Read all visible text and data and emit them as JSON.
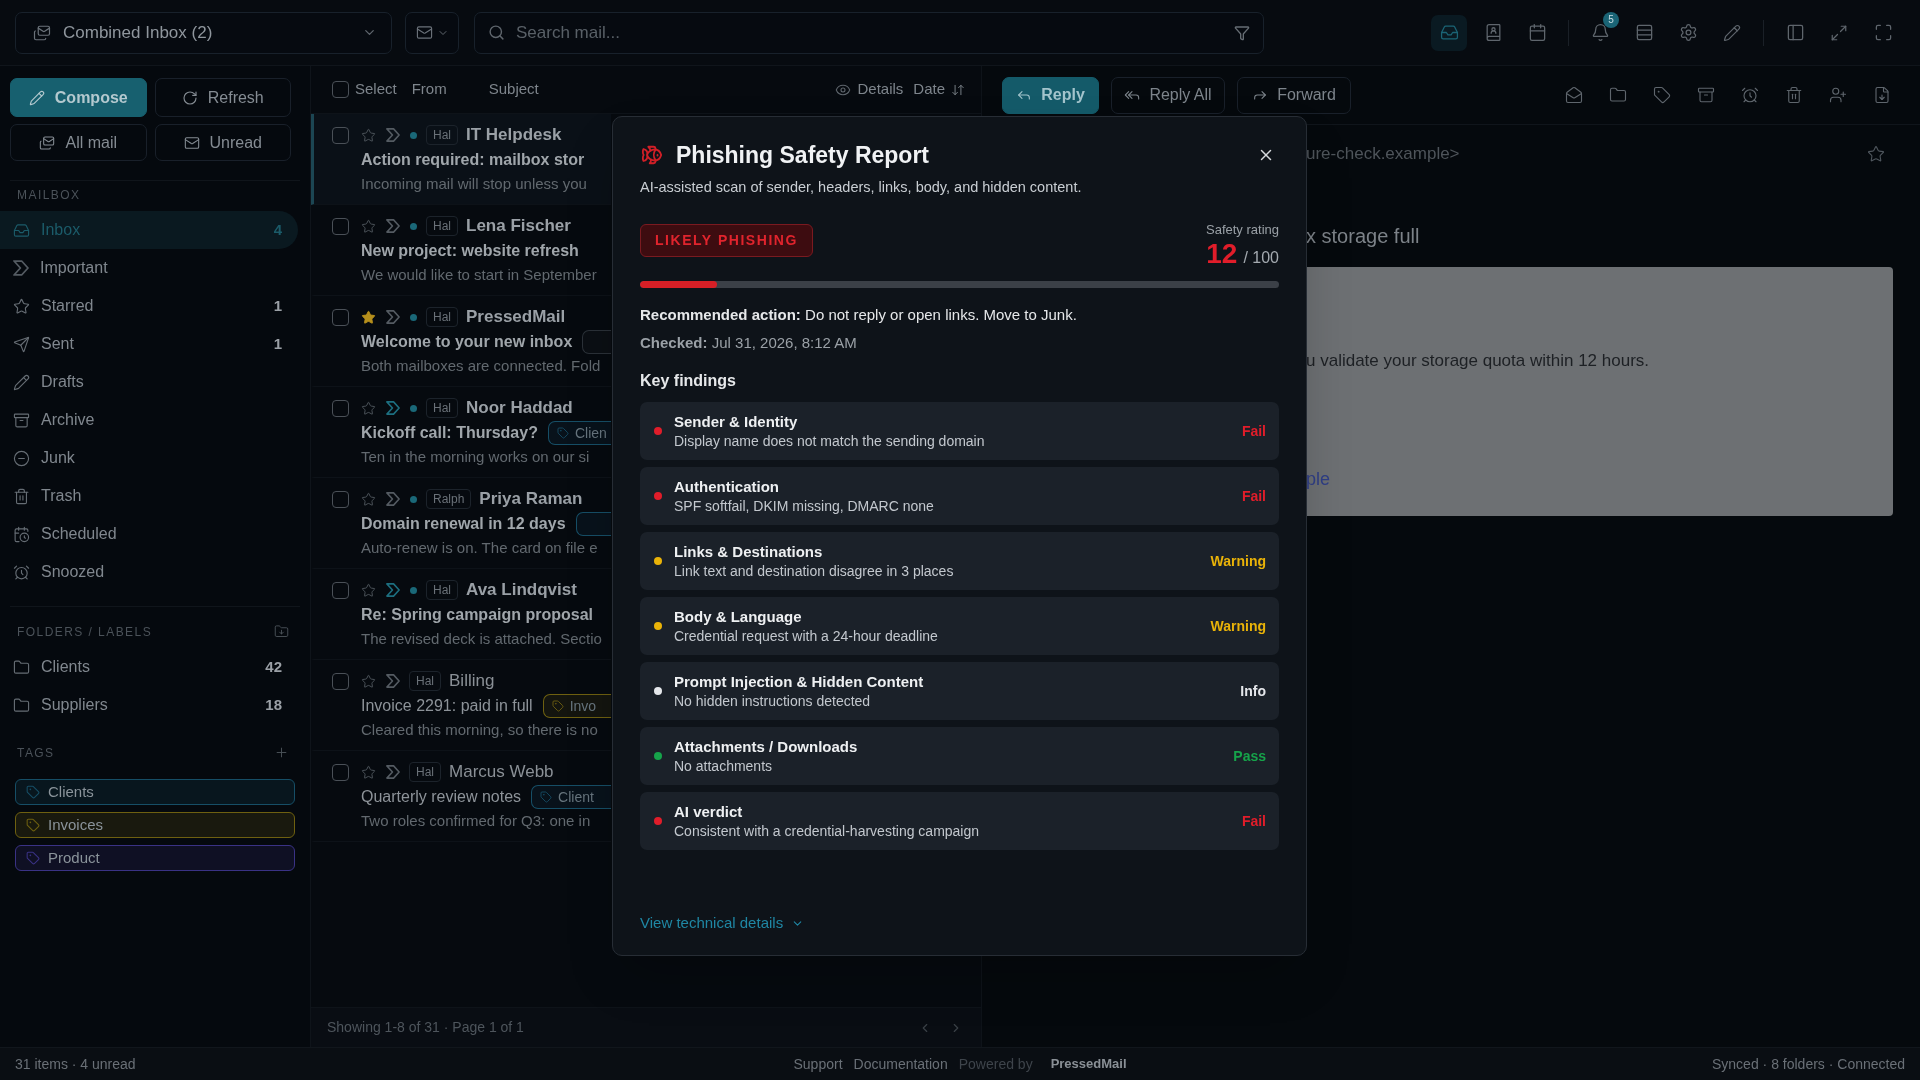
{
  "top_bar": {
    "mailbox_switcher": "Combined Inbox (2)",
    "search": {
      "placeholder": "Search mail..."
    },
    "view_buttons": [
      {
        "selected": true
      },
      {
        "selected": false
      },
      {
        "selected": false
      }
    ],
    "notification_count": "5"
  },
  "sidebar": {
    "buttons": [
      {
        "label": "Compose",
        "kind": "primary"
      },
      {
        "label": "Refresh",
        "kind": "secondary"
      }
    ],
    "filters": [
      "All mail",
      "Unread"
    ],
    "mailbox": {
      "title": "MAILBOX",
      "items": [
        {
          "label": "Inbox",
          "count": "4",
          "selected": true
        },
        {
          "label": "Important",
          "selected": false
        },
        {
          "label": "Starred",
          "count": "1",
          "selected": false
        },
        {
          "label": "Sent",
          "count": "1",
          "selected": false
        },
        {
          "label": "Drafts",
          "selected": false
        },
        {
          "label": "Archive",
          "selected": false
        },
        {
          "label": "Junk",
          "selected": false
        },
        {
          "label": "Trash",
          "selected": false
        },
        {
          "label": "Scheduled",
          "selected": false
        },
        {
          "label": "Snoozed",
          "selected": false
        }
      ]
    },
    "folders": {
      "title": "FOLDERS / LABELS",
      "items": [
        {
          "label": "Clients",
          "count": "42"
        },
        {
          "label": "Suppliers",
          "count": "18"
        }
      ]
    },
    "tags": {
      "title": "TAGS",
      "items": [
        {
          "label": "Clients",
          "color": "#164e66"
        },
        {
          "label": "Invoices",
          "color": "#6e6010"
        },
        {
          "label": "Product",
          "color": "#3a3285"
        }
      ]
    }
  },
  "message_list": {
    "header": {
      "select_all": {
        "label": "Select",
        "checked": false
      },
      "columns": [
        "From",
        "Subject"
      ],
      "details": "Details",
      "sort": "Date"
    },
    "messages": [
      {
        "account": "Hal",
        "sender": "IT Helpdesk",
        "subject": "Action required: mailbox stor",
        "preview": "Incoming mail will stop unless you",
        "unread": true,
        "starred": false,
        "important": false,
        "checked": false,
        "selected": true
      },
      {
        "account": "Hal",
        "sender": "Lena Fischer",
        "subject": "New project: website refresh",
        "preview": "We would like to start in September",
        "unread": true,
        "starred": false,
        "important": false,
        "checked": false,
        "selected": false
      },
      {
        "account": "Hal",
        "sender": "PressedMail",
        "subject": "Welcome to your new inbox",
        "preview": "Both mailboxes are connected. Fold",
        "unread": true,
        "starred": true,
        "important": false,
        "checked": false,
        "selected": false,
        "tag": {
          "color": "#2b3138"
        }
      },
      {
        "account": "Hal",
        "sender": "Noor Haddad",
        "subject": "Kickoff call: Thursday?",
        "preview": "Ten in the morning works on our si",
        "unread": true,
        "starred": false,
        "important": true,
        "checked": false,
        "selected": false,
        "tag": {
          "label": "Clien",
          "color": "#164e66"
        }
      },
      {
        "account": "Ralph",
        "sender": "Priya Raman",
        "subject": "Domain renewal in 12 days",
        "preview": "Auto-renew is on. The card on file e",
        "unread": true,
        "starred": false,
        "important": false,
        "checked": false,
        "selected": false,
        "tag": {
          "color": "#164e66"
        }
      },
      {
        "account": "Hal",
        "sender": "Ava Lindqvist",
        "subject": "Re: Spring campaign proposal",
        "preview": "The revised deck is attached. Sectio",
        "unread": true,
        "starred": false,
        "important": true,
        "checked": false,
        "selected": false
      },
      {
        "account": "Hal",
        "sender": "Billing",
        "subject": "Invoice 2291: paid in full",
        "preview": "Cleared this morning, so there is no",
        "unread": false,
        "starred": false,
        "important": false,
        "checked": false,
        "selected": false,
        "tag": {
          "label": "Invo",
          "color": "#6e6010"
        }
      },
      {
        "account": "Hal",
        "sender": "Marcus Webb",
        "subject": "Quarterly review notes",
        "preview": "Two roles confirmed for Q3: one in",
        "unread": false,
        "starred": false,
        "important": false,
        "checked": false,
        "selected": false,
        "tag": {
          "label": "Client",
          "color": "#164e66"
        }
      }
    ],
    "footer": "Showing 1-8 of 31 · Page 1 of 1"
  },
  "reading_pane": {
    "actions": [
      {
        "label": "Reply",
        "kind": "primary"
      },
      {
        "label": "Reply All",
        "kind": "secondary"
      },
      {
        "label": "Forward",
        "kind": "secondary"
      }
    ],
    "sender_address": "ure-check.example>",
    "subject": "x storage full",
    "body_text": "u validate your storage quota within 12 hours.",
    "body_link": "ple"
  },
  "dialog": {
    "title": "Phishing Safety Report",
    "subtitle": "AI-assisted scan of sender, headers, links, body, and hidden content.",
    "verdict": "LIKELY PHISHING",
    "rating_label": "Safety rating",
    "score": "12",
    "score_max": "/ 100",
    "level": 0.12,
    "recommendation": "**Recommended action:** Do not reply or open links. Move to Junk.",
    "checked_at": "**Checked:** Jul 31, 2026, 8:12 AM",
    "findings_title": "Key findings",
    "findings": [
      {
        "title": "Sender & Identity",
        "detail": "Display name does not match the sending domain",
        "status": "Fail",
        "color": "#e11d2a"
      },
      {
        "title": "Authentication",
        "detail": "SPF softfail, DKIM missing, DMARC none",
        "status": "Fail",
        "color": "#e11d2a"
      },
      {
        "title": "Links & Destinations",
        "detail": "Link text and destination disagree in 3 places",
        "status": "Warning",
        "color": "#eab308"
      },
      {
        "title": "Body & Language",
        "detail": "Credential request with a 24-hour deadline",
        "status": "Warning",
        "color": "#eab308"
      },
      {
        "title": "Prompt Injection & Hidden Content",
        "detail": "No hidden instructions detected",
        "status": "Info",
        "color": "#e5e7eb"
      },
      {
        "title": "Attachments / Downloads",
        "detail": "No attachments",
        "status": "Pass",
        "color": "#16a34a"
      },
      {
        "title": "AI verdict",
        "detail": "Consistent with a credential-harvesting campaign",
        "status": "Fail",
        "color": "#e11d2a"
      }
    ],
    "details_link": "View technical details"
  },
  "status_bar": {
    "summary": "31 items · 4 unread",
    "links": [
      "Support",
      "Documentation"
    ],
    "powered_by": "Powered by",
    "brand": "PressedMail",
    "sync_status": "Synced · 8 folders · Connected"
  }
}
